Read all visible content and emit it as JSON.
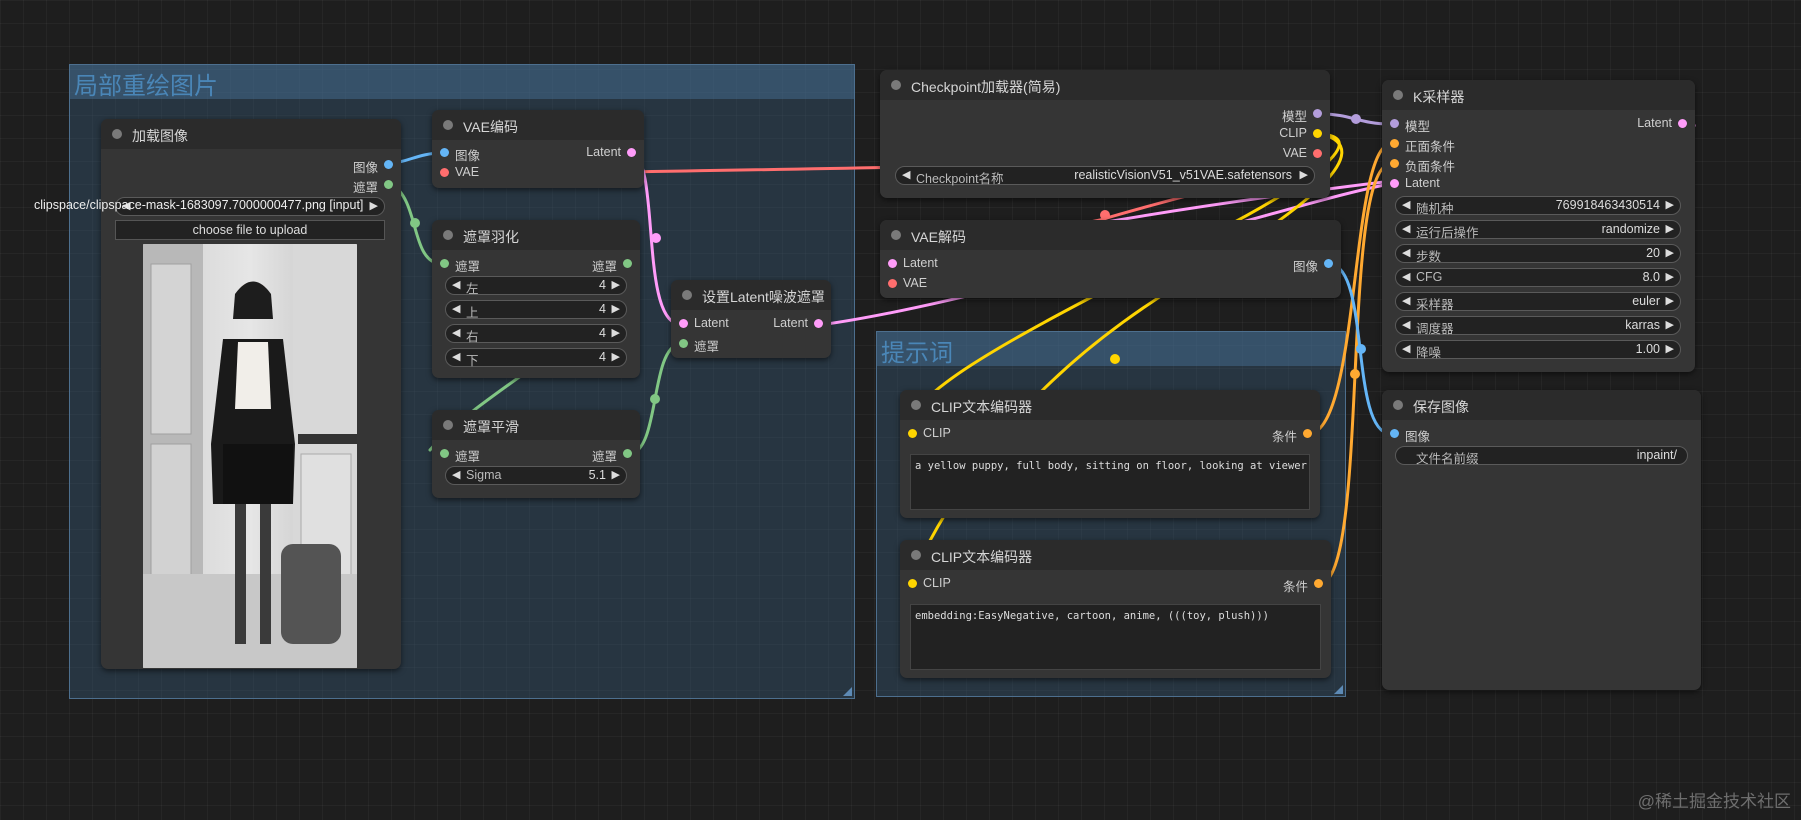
{
  "colors": {
    "model": "#b39ddb",
    "clip": "#ffd500",
    "vae": "#ff6e6e",
    "latent": "#ff9cf9",
    "image": "#64b5f6",
    "mask": "#81c784",
    "conditioning": "#ffa931"
  },
  "groups": {
    "inpaint_title": "局部重绘图片",
    "prompt_title": "提示词"
  },
  "load_image": {
    "title": "加载图像",
    "out_image": "图像",
    "out_mask": "遮罩",
    "file_label": "clipspace/clipspace-mask-1683097.7000000477.png [input]",
    "upload_button": "choose file to upload"
  },
  "vae_encode": {
    "title": "VAE编码",
    "in_image": "图像",
    "in_vae": "VAE",
    "out_latent": "Latent"
  },
  "feather": {
    "title": "遮罩羽化",
    "in_mask": "遮罩",
    "out_mask": "遮罩",
    "widgets": [
      {
        "label": "左",
        "value": "4"
      },
      {
        "label": "上",
        "value": "4"
      },
      {
        "label": "右",
        "value": "4"
      },
      {
        "label": "下",
        "value": "4"
      }
    ]
  },
  "smooth": {
    "title": "遮罩平滑",
    "in_mask": "遮罩",
    "out_mask": "遮罩",
    "sigma_label": "Sigma",
    "sigma_value": "5.1"
  },
  "set_mask": {
    "title": "设置Latent噪波遮罩",
    "in_latent": "Latent",
    "in_mask": "遮罩",
    "out_latent": "Latent"
  },
  "checkpoint": {
    "title": "Checkpoint加载器(简易)",
    "out_model": "模型",
    "out_clip": "CLIP",
    "out_vae": "VAE",
    "ckpt_label": "Checkpoint名称",
    "ckpt_value": "realisticVisionV51_v51VAE.safetensors"
  },
  "vae_decode": {
    "title": "VAE解码",
    "in_latent": "Latent",
    "in_vae": "VAE",
    "out_image": "图像"
  },
  "clip_pos": {
    "title": "CLIP文本编码器",
    "in_clip": "CLIP",
    "out_cond": "条件",
    "text": "a yellow puppy, full body, sitting on floor, looking at viewer"
  },
  "clip_neg": {
    "title": "CLIP文本编码器",
    "in_clip": "CLIP",
    "out_cond": "条件",
    "text": "embedding:EasyNegative, cartoon, anime, (((toy, plush)))"
  },
  "ksampler": {
    "title": "K采样器",
    "in_model": "模型",
    "in_pos": "正面条件",
    "in_neg": "负面条件",
    "in_latent": "Latent",
    "out_latent": "Latent",
    "widgets": [
      {
        "label": "随机种",
        "value": "769918463430514"
      },
      {
        "label": "运行后操作",
        "value": "randomize"
      },
      {
        "label": "步数",
        "value": "20"
      },
      {
        "label": "CFG",
        "value": "8.0"
      },
      {
        "label": "采样器",
        "value": "euler"
      },
      {
        "label": "调度器",
        "value": "karras"
      },
      {
        "label": "降噪",
        "value": "1.00"
      }
    ]
  },
  "save_image": {
    "title": "保存图像",
    "in_image": "图像",
    "prefix_label": "文件名前缀",
    "prefix_value": "inpaint/"
  },
  "watermark": "@稀土掘金技术社区"
}
